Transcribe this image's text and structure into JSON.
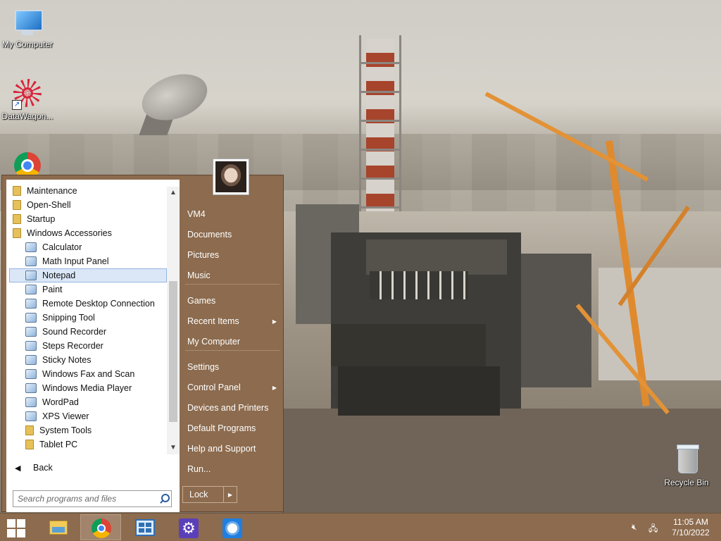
{
  "desktop": {
    "icons": [
      {
        "label": "My Computer",
        "icon": "computer-icon"
      },
      {
        "label": "DataWagon...",
        "icon": "datawagon-icon"
      },
      {
        "label": "",
        "icon": "chrome-icon"
      },
      {
        "label": "Recycle Bin",
        "icon": "recycle-bin-icon"
      }
    ]
  },
  "start_menu": {
    "programs": [
      {
        "label": "Maintenance",
        "icon": "folder-icon",
        "level": 0
      },
      {
        "label": "Open-Shell",
        "icon": "folder-icon",
        "level": 0
      },
      {
        "label": "Startup",
        "icon": "folder-icon",
        "level": 0
      },
      {
        "label": "Windows Accessories",
        "icon": "folder-icon",
        "level": 0
      },
      {
        "label": "Calculator",
        "icon": "calculator-icon",
        "level": 1
      },
      {
        "label": "Math Input Panel",
        "icon": "math-input-icon",
        "level": 1
      },
      {
        "label": "Notepad",
        "icon": "notepad-icon",
        "level": 1,
        "selected": true
      },
      {
        "label": "Paint",
        "icon": "paint-icon",
        "level": 1
      },
      {
        "label": "Remote Desktop Connection",
        "icon": "remote-desktop-icon",
        "level": 1
      },
      {
        "label": "Snipping Tool",
        "icon": "snipping-tool-icon",
        "level": 1
      },
      {
        "label": "Sound Recorder",
        "icon": "microphone-icon",
        "level": 1
      },
      {
        "label": "Steps Recorder",
        "icon": "steps-recorder-icon",
        "level": 1
      },
      {
        "label": "Sticky Notes",
        "icon": "sticky-notes-icon",
        "level": 1
      },
      {
        "label": "Windows Fax and Scan",
        "icon": "fax-icon",
        "level": 1
      },
      {
        "label": "Windows Media Player",
        "icon": "media-player-icon",
        "level": 1
      },
      {
        "label": "WordPad",
        "icon": "wordpad-icon",
        "level": 1
      },
      {
        "label": "XPS Viewer",
        "icon": "xps-viewer-icon",
        "level": 1
      },
      {
        "label": "System Tools",
        "icon": "folder-icon",
        "level": 1
      },
      {
        "label": "Tablet PC",
        "icon": "folder-icon",
        "level": 1
      }
    ],
    "back_label": "Back",
    "search_placeholder": "Search programs and files",
    "right_items": [
      {
        "label": "VM4",
        "has_submenu": false
      },
      {
        "label": "Documents",
        "has_submenu": false
      },
      {
        "label": "Pictures",
        "has_submenu": false
      },
      {
        "label": "Music",
        "has_submenu": false
      },
      {
        "label": "Games",
        "has_submenu": false
      },
      {
        "label": "Recent Items",
        "has_submenu": true
      },
      {
        "label": "My Computer",
        "has_submenu": false
      },
      {
        "label": "Settings",
        "has_submenu": false
      },
      {
        "label": "Control Panel",
        "has_submenu": true
      },
      {
        "label": "Devices and Printers",
        "has_submenu": false
      },
      {
        "label": "Default Programs",
        "has_submenu": false
      },
      {
        "label": "Help and Support",
        "has_submenu": false
      },
      {
        "label": "Run...",
        "has_submenu": false
      }
    ],
    "lock_label": "Lock"
  },
  "taskbar": {
    "buttons": [
      {
        "icon": "file-explorer-icon",
        "active": false
      },
      {
        "icon": "chrome-icon",
        "active": true
      },
      {
        "icon": "control-panel-icon",
        "active": false
      },
      {
        "icon": "settings-gear-icon",
        "active": false
      },
      {
        "icon": "brightness-icon",
        "active": false
      }
    ],
    "tray": {
      "icons": [
        "volume-muted-icon",
        "network-icon"
      ]
    },
    "clock": {
      "time": "11:05 AM",
      "date": "7/10/2022"
    }
  },
  "colors": {
    "menu_bg": "#8c6b4e",
    "selection": "#dbe7f7",
    "selection_border": "#94b5df"
  }
}
